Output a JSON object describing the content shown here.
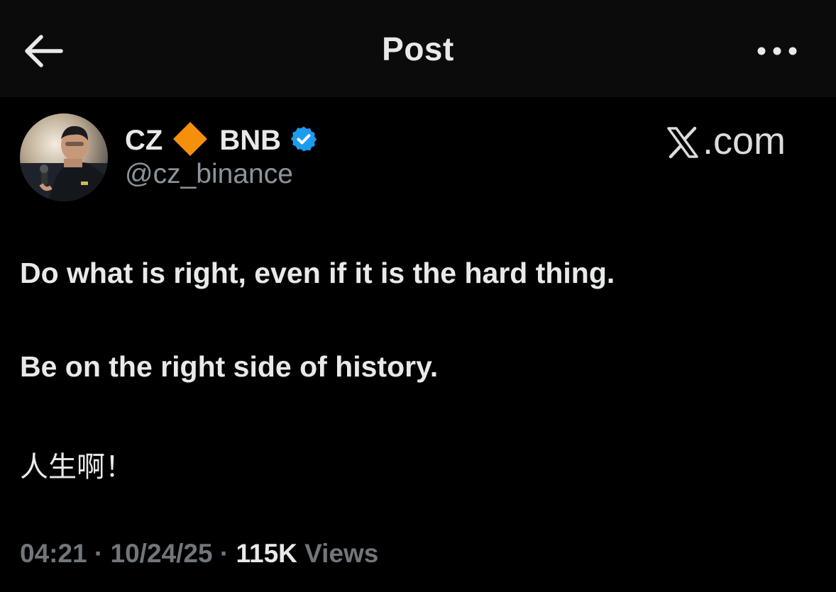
{
  "header": {
    "title": "Post",
    "back_icon": "arrow-left-icon",
    "more_icon": "more-horizontal-icon"
  },
  "author": {
    "name": "CZ",
    "name_suffix": "BNB",
    "handle": "@cz_binance",
    "diamond_icon": "orange-diamond-icon",
    "diamond_color": "#f4900c",
    "verified_icon": "verified-badge-icon",
    "verified_color": "#1d9bf0",
    "avatar": "profile-photo"
  },
  "watermark": {
    "text": ".com",
    "logo": "x-logo-icon"
  },
  "post": {
    "lines": [
      "Do what is right, even if it is the hard thing.",
      "Be on the right side of history.",
      "人生啊！"
    ]
  },
  "meta": {
    "time": "04:21",
    "separator": "·",
    "date": "10/24/25",
    "views_count": "115K",
    "views_label": "Views"
  },
  "colors": {
    "background": "#000000",
    "header_background": "#0b0b0b",
    "text_primary": "#e7e9ea",
    "text_secondary": "#71767b"
  }
}
